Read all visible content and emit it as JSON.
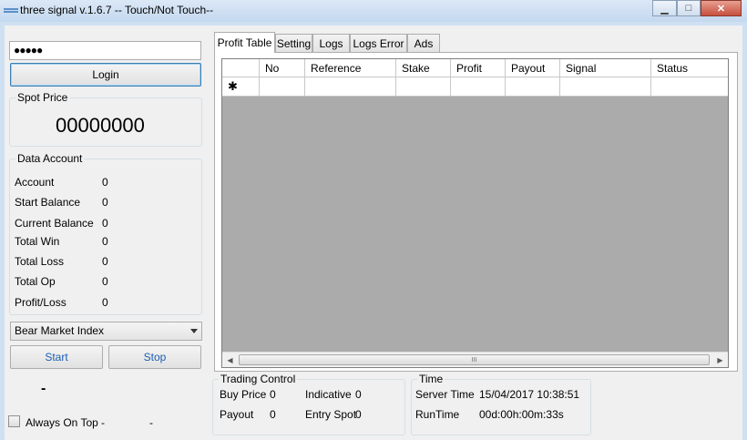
{
  "window": {
    "title": "three signal v.1.6.7 -- Touch/Not Touch--",
    "minimize_glyph": "▁",
    "maximize_glyph": "□",
    "close_glyph": "✕"
  },
  "login": {
    "password_value": "●●●●●",
    "login_label": "Login"
  },
  "spot_price": {
    "title": "Spot Price",
    "value": "00000000"
  },
  "data_account": {
    "title": "Data Account",
    "rows": [
      {
        "label": "Account",
        "value": "0"
      },
      {
        "label": "Start Balance",
        "value": "0"
      },
      {
        "label": "Current Balance",
        "value": "0"
      },
      {
        "label": "Total Win",
        "value": "0"
      },
      {
        "label": "Total Loss",
        "value": "0"
      },
      {
        "label": "Total Op",
        "value": "0"
      },
      {
        "label": "Profit/Loss",
        "value": "0"
      }
    ]
  },
  "market_select": {
    "selected": "Bear Market Index"
  },
  "controls": {
    "start_label": "Start",
    "stop_label": "Stop",
    "status_dash": "-",
    "always_on_top_label": "Always On Top",
    "dash_a": "-",
    "dash_b": "-"
  },
  "tabs": [
    "Profit Table",
    "Setting",
    "Logs",
    "Logs Error",
    "Ads"
  ],
  "grid": {
    "columns": [
      "No",
      "Reference",
      "Stake",
      "Profit",
      "Payout",
      "Signal",
      "Status"
    ],
    "new_row_glyph": "✱",
    "scroll_left_glyph": "◀",
    "scroll_right_glyph": "▶",
    "thumb_grip": "III"
  },
  "trading_control": {
    "title": "Trading Control",
    "buy_price_label": "Buy Price",
    "buy_price_value": "0",
    "indicative_label": "Indicative",
    "indicative_value": "0",
    "payout_label": "Payout",
    "payout_value": "0",
    "entry_spot_label": "Entry Spot",
    "entry_spot_value": "0"
  },
  "time": {
    "title": "Time",
    "server_time_label": "Server Time",
    "server_time_value": "15/04/2017 10:38:51",
    "runtime_label": "RunTime",
    "runtime_value": "00d:00h:00m:33s"
  }
}
